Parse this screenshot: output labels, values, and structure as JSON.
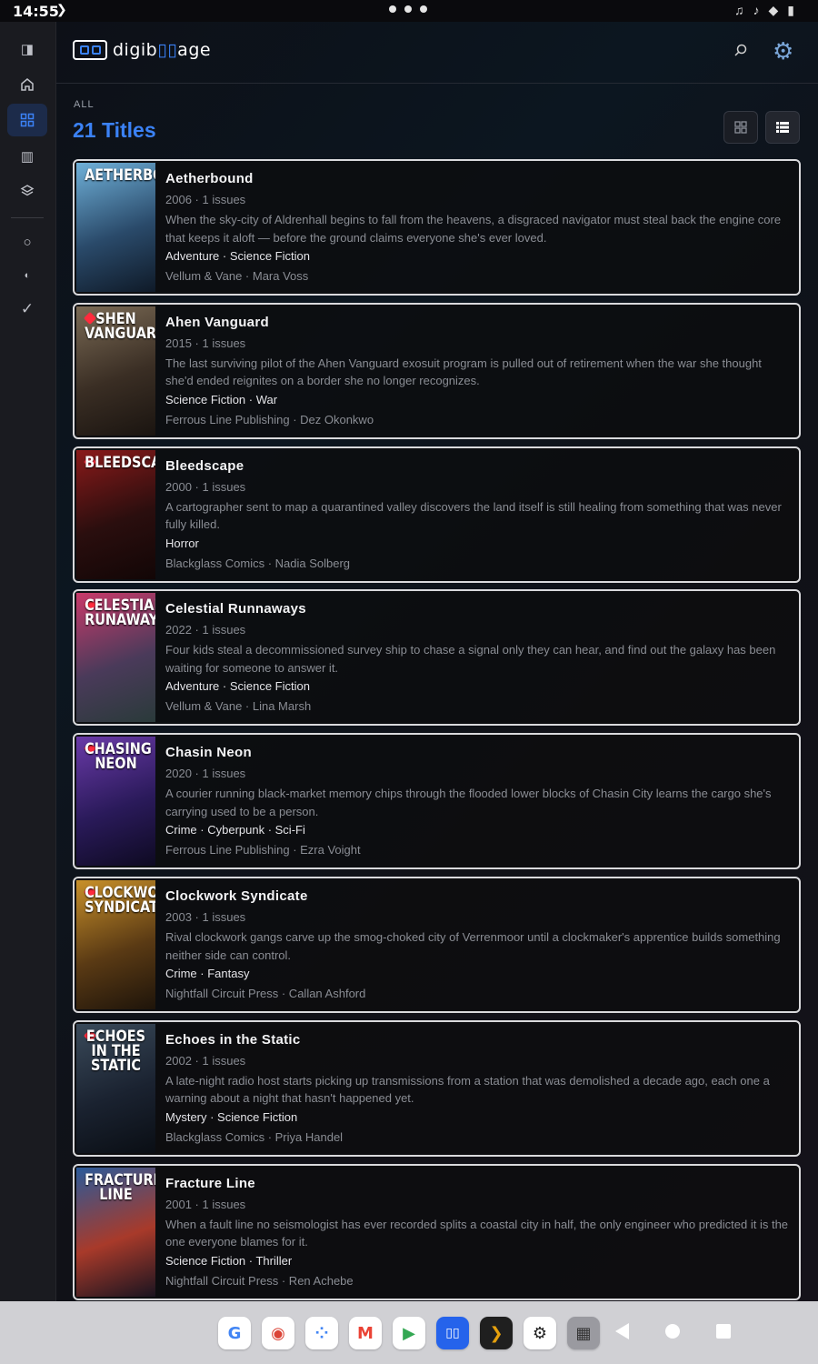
{
  "status": {
    "time": "14:55"
  },
  "app": {
    "logo_prefix": "digib",
    "logo_suffix": "age"
  },
  "header": {
    "eyebrow": "ALL",
    "title": "21 Titles"
  },
  "colors": {
    "accent": "#3b82f6",
    "card_border": "#d9d9dc",
    "muted_text": "#8a8d94"
  },
  "rail": {
    "items": [
      {
        "icon": "sidebar-toggle-icon"
      },
      {
        "icon": "home-icon"
      },
      {
        "icon": "grid-icon",
        "active": true
      },
      {
        "icon": "book-open-icon"
      },
      {
        "icon": "layers-icon"
      },
      {
        "icon": "circle-icon"
      },
      {
        "icon": "half-circle-icon"
      },
      {
        "icon": "check-icon"
      }
    ]
  },
  "titles": [
    {
      "name": "Aetherbound",
      "year": "2006",
      "issues": "1 issues",
      "description": "When the sky-city of Aldrenhall begins to fall from the heavens, a disgraced navigator must steal back the engine core that keeps it aloft — before the ground claims everyone she's ever loved.",
      "genres": "Adventure · Science Fiction",
      "publisher": "Vellum & Vane · Mara Voss",
      "cover": {
        "title": "AETHERBOUND",
        "colors": [
          "#6fb0d8",
          "#2a4a6a",
          "#0f1a28"
        ],
        "favorite": false
      }
    },
    {
      "name": "Ahen Vanguard",
      "year": "2015",
      "issues": "1 issues",
      "description": "The last surviving pilot of the Ahen Vanguard exosuit program is pulled out of retirement when the war she thought she'd ended reignites on a border she no longer recognizes.",
      "genres": "Science Fiction · War",
      "publisher": "Ferrous Line Publishing · Dez Okonkwo",
      "cover": {
        "title": "SHEN VANGUARD",
        "colors": [
          "#7a6a55",
          "#3a2e24",
          "#1a1410"
        ],
        "favorite": true
      }
    },
    {
      "name": "Bleedscape",
      "year": "2000",
      "issues": "1 issues",
      "description": "A cartographer sent to map a quarantined valley discovers the land itself is still healing from something that was never fully killed.",
      "genres": "Horror",
      "publisher": "Blackglass Comics · Nadia Solberg",
      "cover": {
        "title": "BLEEDSCAPE",
        "colors": [
          "#8a1a1a",
          "#2a0e0e",
          "#120606"
        ],
        "favorite": true
      }
    },
    {
      "name": "Celestial Runnaways",
      "year": "2022",
      "issues": "1 issues",
      "description": "Four kids steal a decommissioned survey ship to chase a signal only they can hear, and find out the galaxy has been waiting for someone to answer it.",
      "genres": "Adventure · Science Fiction",
      "publisher": "Vellum & Vane · Lina Marsh",
      "cover": {
        "title": "CELESTIAL RUNAWAYS",
        "colors": [
          "#c83a6a",
          "#4a3a5a",
          "#2a3a3a"
        ],
        "favorite": true
      }
    },
    {
      "name": "Chasin Neon",
      "year": "2020",
      "issues": "1 issues",
      "description": "A courier running black-market memory chips through the flooded lower blocks of Chasin City learns the cargo she's carrying used to be a person.",
      "genres": "Crime · Cyberpunk · Sci-Fi",
      "publisher": "Ferrous Line Publishing · Ezra Voight",
      "cover": {
        "title": "CHASING NEON",
        "colors": [
          "#6a3aa8",
          "#2a1a5a",
          "#0e0a22"
        ],
        "favorite": true
      }
    },
    {
      "name": "Clockwork Syndicate",
      "year": "2003",
      "issues": "1 issues",
      "description": "Rival clockwork gangs carve up the smog-choked city of Verrenmoor until a clockmaker's apprentice builds something neither side can control.",
      "genres": "Crime · Fantasy",
      "publisher": "Nightfall Circuit Press · Callan Ashford",
      "cover": {
        "title": "CLOCKWORK SYNDICATE",
        "colors": [
          "#c8902a",
          "#5a3a14",
          "#1e140a"
        ],
        "favorite": true
      }
    },
    {
      "name": "Echoes in the Static",
      "year": "2002",
      "issues": "1 issues",
      "description": "A late-night radio host starts picking up transmissions from a station that was demolished a decade ago, each one a warning about a night that hasn't happened yet.",
      "genres": "Mystery · Science Fiction",
      "publisher": "Blackglass Comics · Priya Handel",
      "cover": {
        "title": "ECHOES IN THE STATIC",
        "colors": [
          "#3a4a5a",
          "#1a2230",
          "#0a0e14"
        ],
        "favorite": true
      }
    },
    {
      "name": "Fracture Line",
      "year": "2001",
      "issues": "1 issues",
      "description": "When a fault line no seismologist has ever recorded splits a coastal city in half, the only engineer who predicted it is the one everyone blames for it.",
      "genres": "Science Fiction · Thriller",
      "publisher": "Nightfall Circuit Press · Ren Achebe",
      "cover": {
        "title": "FRACTURE LINE",
        "colors": [
          "#2a5a9a",
          "#a83a2a",
          "#1a1420"
        ],
        "favorite": false
      }
    }
  ],
  "dock": [
    {
      "icon": "google-icon",
      "glyph": "G",
      "color": "#4285f4"
    },
    {
      "icon": "chrome-icon",
      "glyph": "◉",
      "color": "#db4437"
    },
    {
      "icon": "assistant-icon",
      "glyph": "⁘",
      "color": "#4285f4"
    },
    {
      "icon": "gmail-icon",
      "glyph": "M",
      "color": "#ea4335"
    },
    {
      "icon": "play-store-icon",
      "glyph": "▶",
      "color": "#34a853"
    },
    {
      "icon": "digibooage-app-icon",
      "glyph": "▯▯",
      "color": "#ffffff"
    },
    {
      "icon": "plex-icon",
      "glyph": "❯",
      "color": "#e5a00d"
    },
    {
      "icon": "settings-icon",
      "glyph": "⚙",
      "color": "#222222"
    },
    {
      "icon": "app-drawer-icon",
      "glyph": "▦",
      "color": "#333333"
    }
  ]
}
